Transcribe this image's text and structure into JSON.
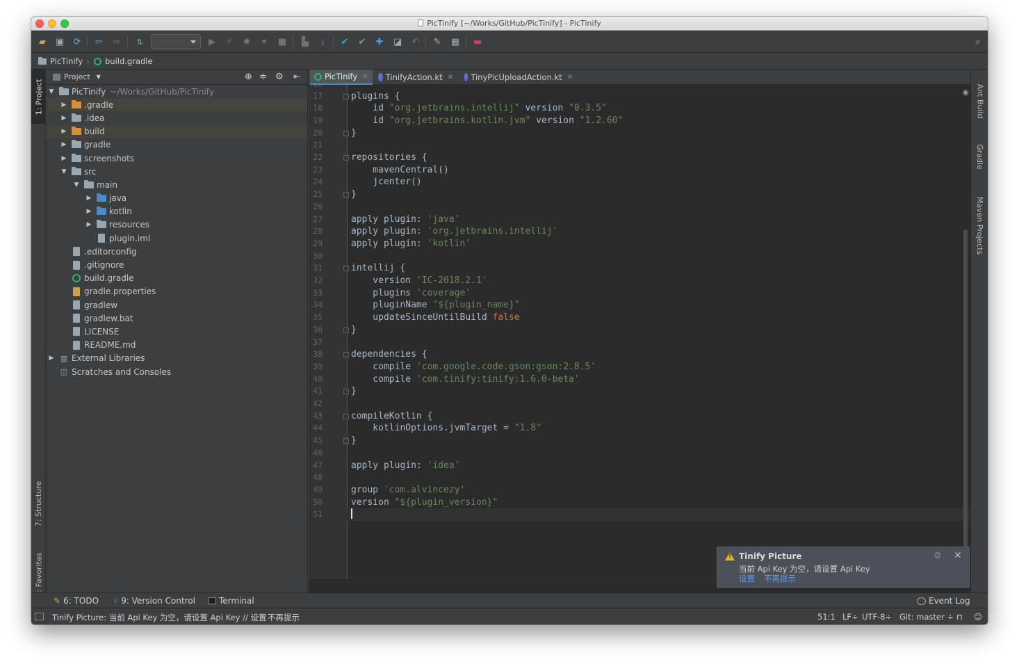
{
  "window": {
    "title": "PicTinify [~/Works/GitHub/PicTinify] - PicTinify"
  },
  "navbar": {
    "project": "PicTinify",
    "file": "build.gradle"
  },
  "left_stripe": {
    "project_tab": "1: Project",
    "structure_tab": "7: Structure",
    "favorites_tab": "2: Favorites"
  },
  "right_stripe": {
    "ant": "Ant Build",
    "gradle": "Gradle",
    "maven": "Maven Projects"
  },
  "project_panel": {
    "title": "Project",
    "root": {
      "name": "PicTinify",
      "path": "~/Works/GitHub/PicTinify"
    },
    "items": [
      {
        "label": ".gradle"
      },
      {
        "label": ".idea"
      },
      {
        "label": "build"
      },
      {
        "label": "gradle"
      },
      {
        "label": "screenshots"
      },
      {
        "label": "src"
      },
      {
        "label": "main"
      },
      {
        "label": "java"
      },
      {
        "label": "kotlin"
      },
      {
        "label": "resources"
      },
      {
        "label": "plugin.iml"
      },
      {
        "label": ".editorconfig"
      },
      {
        "label": ".gitignore"
      },
      {
        "label": "build.gradle"
      },
      {
        "label": "gradle.properties"
      },
      {
        "label": "gradlew"
      },
      {
        "label": "gradlew.bat"
      },
      {
        "label": "LICENSE"
      },
      {
        "label": "README.md"
      },
      {
        "label": "External Libraries"
      },
      {
        "label": "Scratches and Consoles"
      }
    ]
  },
  "tabs": [
    {
      "label": "PicTinify"
    },
    {
      "label": "TinifyAction.kt"
    },
    {
      "label": "TinyPicUploadAction.kt"
    }
  ],
  "editor": {
    "first_line": "16",
    "lines": [
      {
        "n": "17",
        "t": "plugins {"
      },
      {
        "n": "18",
        "t": "    id ",
        "s": "\"org.jetbrains.intellij\"",
        "t2": " version ",
        "s2": "\"0.3.5\""
      },
      {
        "n": "19",
        "t": "    id ",
        "s": "\"org.jetbrains.kotlin.jvm\"",
        "t2": " version ",
        "s2": "\"1.2.60\""
      },
      {
        "n": "20",
        "t": "}"
      },
      {
        "n": "21",
        "t": ""
      },
      {
        "n": "22",
        "t": "repositories {"
      },
      {
        "n": "23",
        "t": "    mavenCentral()"
      },
      {
        "n": "24",
        "t": "    jcenter()"
      },
      {
        "n": "25",
        "t": "}"
      },
      {
        "n": "26",
        "t": ""
      },
      {
        "n": "27",
        "t": "apply plugin: ",
        "s": "'java'"
      },
      {
        "n": "28",
        "t": "apply plugin: ",
        "s": "'org.jetbrains.intellij'"
      },
      {
        "n": "29",
        "t": "apply plugin: ",
        "s": "'kotlin'"
      },
      {
        "n": "30",
        "t": ""
      },
      {
        "n": "31",
        "t": "intellij {"
      },
      {
        "n": "32",
        "t": "    version ",
        "s": "'IC-2018.2.1'"
      },
      {
        "n": "33",
        "t": "    plugins ",
        "s": "'coverage'"
      },
      {
        "n": "34",
        "t": "    pluginName ",
        "s": "\"${plugin_name}\""
      },
      {
        "n": "35",
        "t": "    updateSinceUntilBuild ",
        "k": "false"
      },
      {
        "n": "36",
        "t": "}"
      },
      {
        "n": "37",
        "t": ""
      },
      {
        "n": "38",
        "t": "dependencies {"
      },
      {
        "n": "39",
        "t": "    compile ",
        "s": "'com.google.code.gson:gson:2.8.5'"
      },
      {
        "n": "40",
        "t": "    compile ",
        "s": "'com.tinify:tinify:1.6.0-beta'"
      },
      {
        "n": "41",
        "t": "}"
      },
      {
        "n": "42",
        "t": ""
      },
      {
        "n": "43",
        "t": "compileKotlin {"
      },
      {
        "n": "44",
        "t": "    kotlinOptions.jvmTarget = ",
        "s": "\"1.8\""
      },
      {
        "n": "45",
        "t": "}"
      },
      {
        "n": "46",
        "t": ""
      },
      {
        "n": "47",
        "t": "apply plugin: ",
        "s": "'idea'"
      },
      {
        "n": "48",
        "t": ""
      },
      {
        "n": "49",
        "t": "group ",
        "s": "'com.alvincezy'"
      },
      {
        "n": "50",
        "t": "version ",
        "s": "\"${plugin_version}\""
      },
      {
        "n": "51",
        "t": ""
      }
    ]
  },
  "tool_windows": {
    "todo": "6: TODO",
    "vcs": "9: Version Control",
    "terminal": "Terminal",
    "event_log": "Event Log"
  },
  "notification": {
    "title": "Tinify Picture",
    "message": "当前 Api Key 为空，请设置 Api Key",
    "link_settings": "设置",
    "link_dismiss": "不再提示"
  },
  "status_bar": {
    "message": "Tinify Picture: 当前 Api Key 为空，请设置 Api Key // 设置",
    "dismiss": "不再提示",
    "position": "51:1",
    "line_sep": "LF÷",
    "encoding": "UTF-8÷",
    "git": "Git: master ÷"
  },
  "colors": {
    "accent": "#4a88c7",
    "warning": "#e5b323",
    "link": "#589df6",
    "string": "#6a8759",
    "keyword": "#cc7832"
  }
}
